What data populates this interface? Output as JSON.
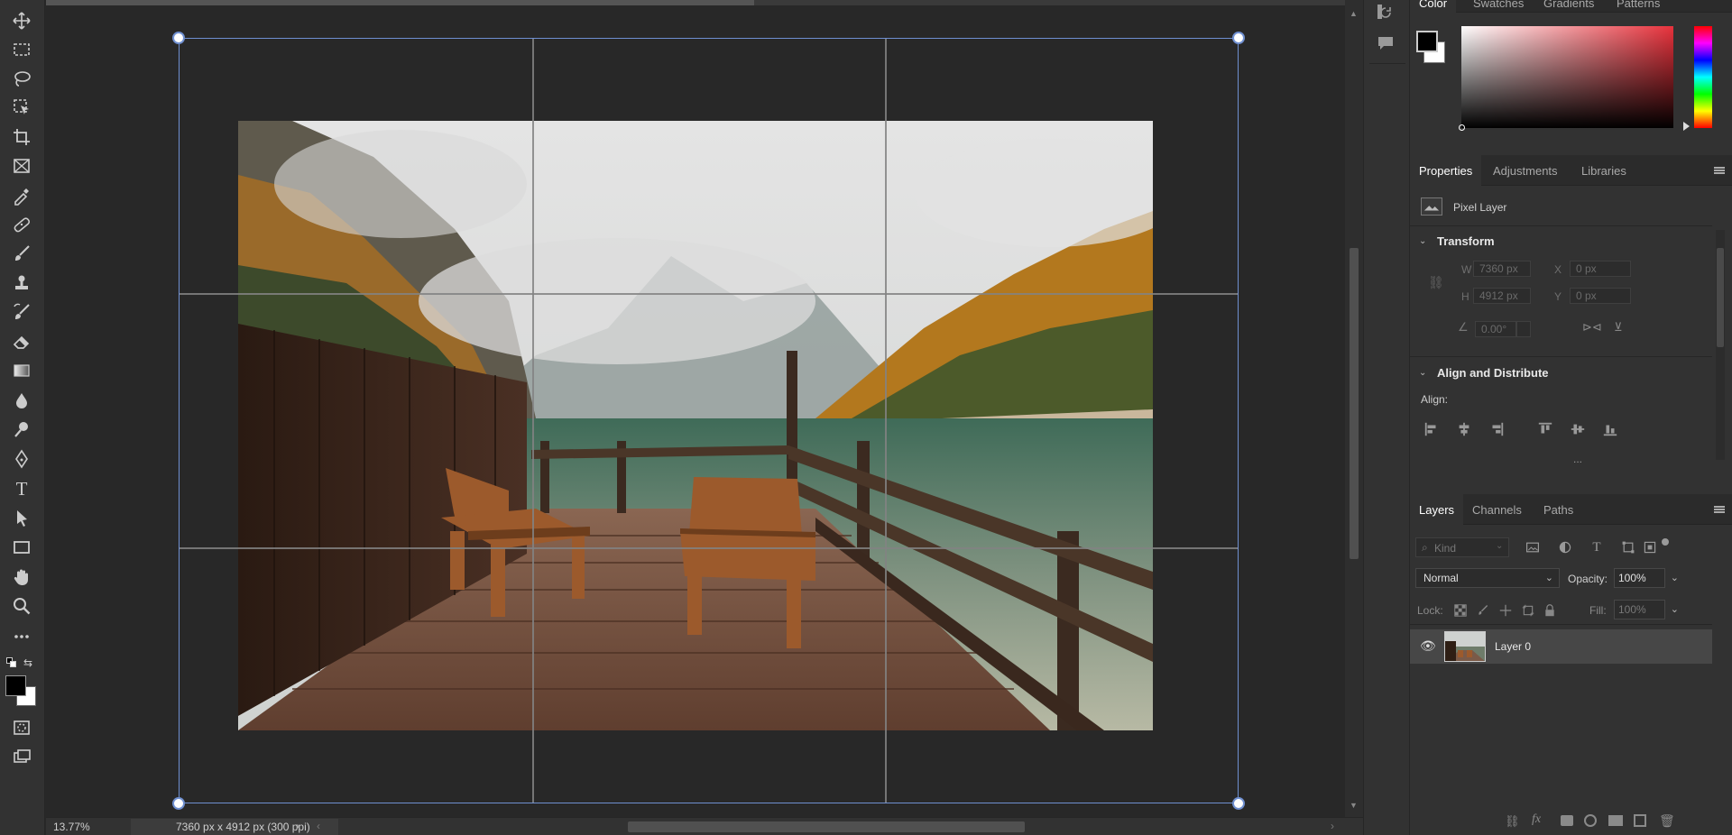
{
  "toolbar": {
    "tools": [
      {
        "name": "move-tool",
        "icon": "move-icon"
      },
      {
        "name": "rectangular-marquee-tool",
        "icon": "marquee-icon"
      },
      {
        "name": "lasso-tool",
        "icon": "lasso-icon"
      },
      {
        "name": "object-selection-tool",
        "icon": "object-select-icon"
      },
      {
        "name": "crop-tool",
        "icon": "crop-icon"
      },
      {
        "name": "frame-tool",
        "icon": "frame-icon"
      },
      {
        "name": "eyedropper-tool",
        "icon": "eyedropper-icon"
      },
      {
        "name": "healing-brush-tool",
        "icon": "bandage-icon"
      },
      {
        "name": "brush-tool",
        "icon": "brush-icon"
      },
      {
        "name": "clone-stamp-tool",
        "icon": "stamp-icon"
      },
      {
        "name": "history-brush-tool",
        "icon": "history-brush-icon"
      },
      {
        "name": "eraser-tool",
        "icon": "eraser-icon"
      },
      {
        "name": "gradient-tool",
        "icon": "gradient-icon"
      },
      {
        "name": "blur-tool",
        "icon": "drop-icon"
      },
      {
        "name": "dodge-tool",
        "icon": "dodge-icon"
      },
      {
        "name": "pen-tool",
        "icon": "pen-icon"
      },
      {
        "name": "type-tool",
        "icon": "type-icon"
      },
      {
        "name": "path-selection-tool",
        "icon": "arrow-icon"
      },
      {
        "name": "rectangle-tool",
        "icon": "rectangle-icon"
      },
      {
        "name": "hand-tool",
        "icon": "hand-icon"
      },
      {
        "name": "zoom-tool",
        "icon": "zoom-icon"
      },
      {
        "name": "edit-toolbar",
        "icon": "ellipsis-icon"
      }
    ],
    "foreground_color": "#000000",
    "background_color": "#ffffff",
    "type_glyph": "T"
  },
  "status": {
    "zoom": "13.77%",
    "doc_info": "7360 px x 4912 px (300 ppi)"
  },
  "color_panel": {
    "tabs": [
      "Color",
      "Swatches",
      "Gradients",
      "Patterns"
    ],
    "active_tab": "Color",
    "hue_color": "#e8323c"
  },
  "properties_panel": {
    "tabs": [
      "Properties",
      "Adjustments",
      "Libraries"
    ],
    "active_tab": "Properties",
    "layer_kind": "Pixel Layer",
    "transform": {
      "title": "Transform",
      "w_label": "W",
      "w_value": "7360 px",
      "x_label": "X",
      "x_value": "0 px",
      "h_label": "H",
      "h_value": "4912 px",
      "y_label": "Y",
      "y_value": "0 px",
      "angle_value": "0.00°"
    },
    "align": {
      "title": "Align and Distribute",
      "label": "Align:",
      "more": "..."
    }
  },
  "layers_panel": {
    "tabs": [
      "Layers",
      "Channels",
      "Paths"
    ],
    "active_tab": "Layers",
    "filter_placeholder": "Kind",
    "blend_mode": "Normal",
    "opacity_label": "Opacity:",
    "opacity_value": "100%",
    "lock_label": "Lock:",
    "fill_label": "Fill:",
    "fill_value": "100%",
    "layers": [
      {
        "name": "Layer 0",
        "visible": true,
        "selected": true
      }
    ]
  }
}
